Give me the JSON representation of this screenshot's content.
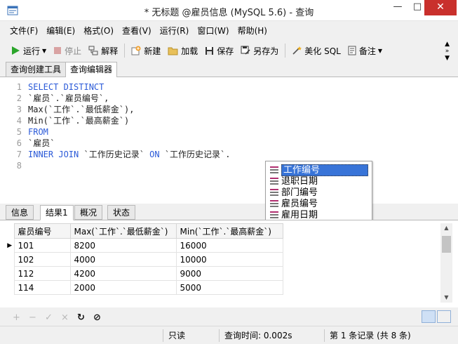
{
  "window": {
    "title": "* 无标题 @雇员信息 (MySQL 5.6) - 查询"
  },
  "menu": [
    "文件(F)",
    "编辑(E)",
    "格式(O)",
    "查看(V)",
    "运行(R)",
    "窗口(W)",
    "帮助(H)"
  ],
  "toolbar": {
    "run": "运行",
    "stop": "停止",
    "explain": "解释",
    "new": "新建",
    "load": "加载",
    "save": "保存",
    "save_as": "另存为",
    "beautify": "美化 SQL",
    "backup": "备注"
  },
  "editor_tabs": [
    "查询创建工具",
    "查询编辑器"
  ],
  "code": {
    "numbers": [
      "1",
      "2",
      "3",
      "4",
      "5",
      "6",
      "7",
      "8"
    ],
    "l1": "SELECT DISTINCT",
    "l2": "`雇员`.`雇员编号`,",
    "l3": "Max(`工作`.`最低薪金`),",
    "l4": "Min(`工作`.`最高薪金`)",
    "l5": "FROM",
    "l6": "`雇员`",
    "l7_kw1": "INNER JOIN",
    "l7_t1": " `工作历史记录` ",
    "l7_kw2": "ON",
    "l7_t2": " `工作历史记录`."
  },
  "autocomplete": [
    "工作编号",
    "退职日期",
    "部门编号",
    "雇员编号",
    "雇用日期"
  ],
  "result_tabs": [
    "信息",
    "结果1",
    "概况",
    "状态"
  ],
  "grid": {
    "columns": [
      "雇员编号",
      "Max(`工作`.`最低薪金`)",
      "Min(`工作`.`最高薪金`)"
    ],
    "rows": [
      [
        "101",
        "8200",
        "16000"
      ],
      [
        "102",
        "4000",
        "10000"
      ],
      [
        "112",
        "4200",
        "9000"
      ],
      [
        "114",
        "2000",
        "5000"
      ]
    ]
  },
  "grid_toolbar": [
    "+",
    "−",
    "✓",
    "×",
    "↻",
    "⊘"
  ],
  "status": {
    "readonly": "只读",
    "query_time": "查询时间: 0.002s",
    "record": "第 1 条记录 (共 8 条)"
  }
}
